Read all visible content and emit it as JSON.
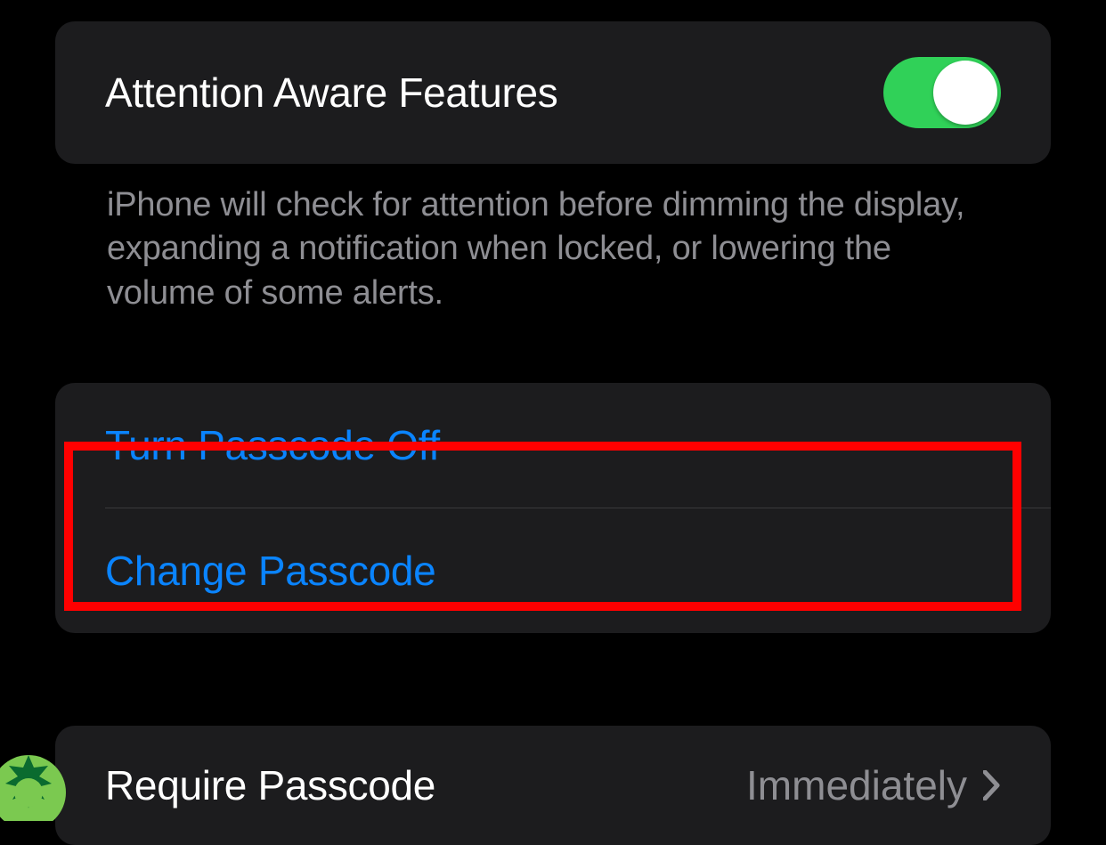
{
  "settings": {
    "attention_aware": {
      "label": "Attention Aware Features",
      "enabled": true,
      "footer": "iPhone will check for attention before dimming the display, expanding a notification when locked, or lowering the volume of some alerts."
    },
    "passcode_actions": {
      "turn_off_label": "Turn Passcode Off",
      "change_label": "Change Passcode"
    },
    "require_passcode": {
      "label": "Require Passcode",
      "value": "Immediately"
    }
  },
  "highlight": {
    "target": "change-passcode-row"
  },
  "colors": {
    "background": "#000000",
    "card": "#1c1c1e",
    "text_primary": "#ffffff",
    "text_secondary": "#8e8e93",
    "link": "#0a84ff",
    "toggle_on": "#30d158",
    "highlight": "#ff0000"
  }
}
